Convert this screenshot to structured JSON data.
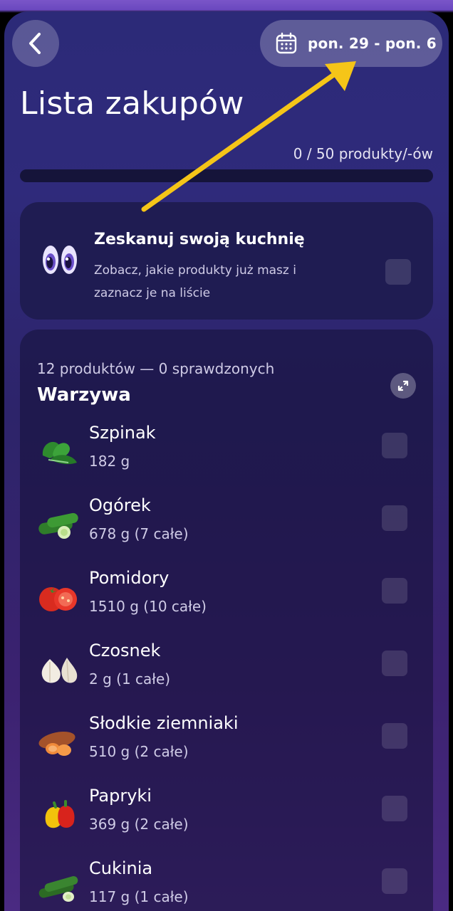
{
  "header": {
    "back_icon": "chevron-left-icon",
    "calendar_icon": "calendar-icon",
    "date_range": "pon. 29 - pon. 6"
  },
  "page": {
    "title": "Lista zakupów",
    "count": "0 / 50 produkty/-ów",
    "progress": 0
  },
  "scan": {
    "icon": "eyes-icon",
    "title": "Zeskanuj swoją kuchnię",
    "subtitle": "Zobacz, jakie produkty już masz i zaznacz je na liście"
  },
  "category": {
    "summary": "12 produktów — 0 sprawdzonych",
    "title": "Warzywa",
    "expand_icon": "expand-icon",
    "items": [
      {
        "name": "Szpinak",
        "qty": "182 g",
        "icon": "spinach-icon"
      },
      {
        "name": "Ogórek",
        "qty": "678 g  (7 całe)",
        "icon": "cucumber-icon"
      },
      {
        "name": "Pomidory",
        "qty": "1510 g  (10 całe)",
        "icon": "tomato-icon"
      },
      {
        "name": "Czosnek",
        "qty": "2 g  (1 całe)",
        "icon": "garlic-icon"
      },
      {
        "name": "Słodkie ziemniaki",
        "qty": "510 g  (2 całe)",
        "icon": "sweet-potato-icon"
      },
      {
        "name": "Papryki",
        "qty": "369 g  (2 całe)",
        "icon": "pepper-icon"
      },
      {
        "name": "Cukinia",
        "qty": "117 g  (1 całe)",
        "icon": "zucchini-icon"
      }
    ]
  },
  "colors": {
    "accent": "#8b6cff",
    "annotation_arrow": "#f5c518",
    "card": "#1f1c52"
  }
}
